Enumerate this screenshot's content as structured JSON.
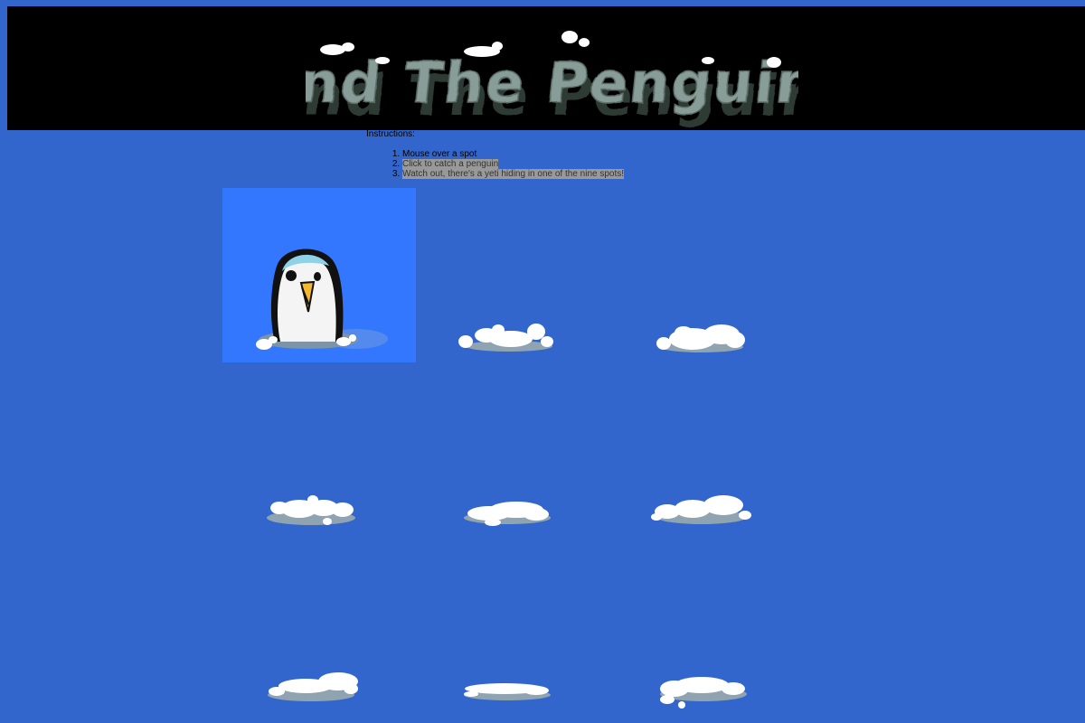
{
  "game": {
    "title": "Find The Penguins",
    "instructions_label": "Instructions:",
    "instructions": [
      "Mouse over a spot",
      "Click to catch a penguin",
      "Watch out, there's a yeti hiding in one of the nine spots!"
    ]
  },
  "spots": [
    {
      "name": "spot-1",
      "state": "penguin-revealed"
    },
    {
      "name": "spot-2",
      "state": "snow-pile"
    },
    {
      "name": "spot-3",
      "state": "snow-pile"
    },
    {
      "name": "spot-4",
      "state": "snow-pile"
    },
    {
      "name": "spot-5",
      "state": "snow-pile"
    },
    {
      "name": "spot-6",
      "state": "snow-pile"
    },
    {
      "name": "spot-7",
      "state": "snow-pile"
    },
    {
      "name": "spot-8",
      "state": "snow-pile"
    },
    {
      "name": "spot-9",
      "state": "snow-pile"
    }
  ],
  "colors": {
    "background": "#3366cc",
    "banner": "#000000",
    "active_spot": "#3377ff",
    "snow": "#ffffff",
    "ice_shadow": "#8fa3b0",
    "instruction_highlight": "#999999"
  }
}
